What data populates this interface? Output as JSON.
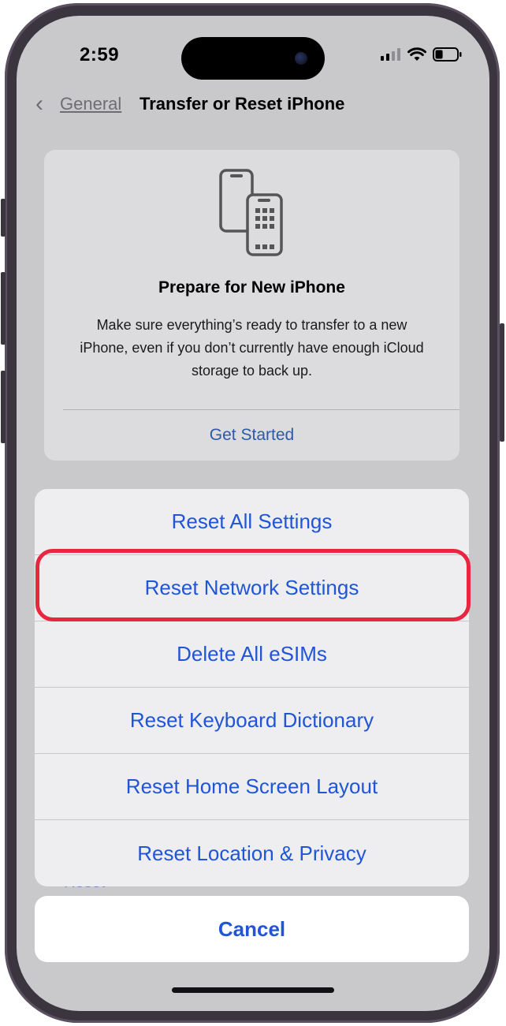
{
  "status_bar": {
    "time": "2:59",
    "battery_level": 0.35
  },
  "nav": {
    "back_label": "General",
    "title": "Transfer or Reset iPhone"
  },
  "card": {
    "title": "Prepare for New iPhone",
    "description": "Make sure everything’s ready to transfer to a new iPhone, even if you don’t currently have enough iCloud storage to back up.",
    "action": "Get Started"
  },
  "background_row": {
    "label": "Reset"
  },
  "action_sheet": {
    "items": [
      {
        "label": "Reset All Settings"
      },
      {
        "label": "Reset Network Settings"
      },
      {
        "label": "Delete All eSIMs"
      },
      {
        "label": "Reset Keyboard Dictionary"
      },
      {
        "label": "Reset Home Screen Layout"
      },
      {
        "label": "Reset Location & Privacy"
      }
    ],
    "cancel": "Cancel",
    "highlighted_item": "Reset Network Settings",
    "highlight_color": "#e8263f"
  },
  "colors": {
    "link": "#1f55d6",
    "background": "#c9c9cc"
  }
}
